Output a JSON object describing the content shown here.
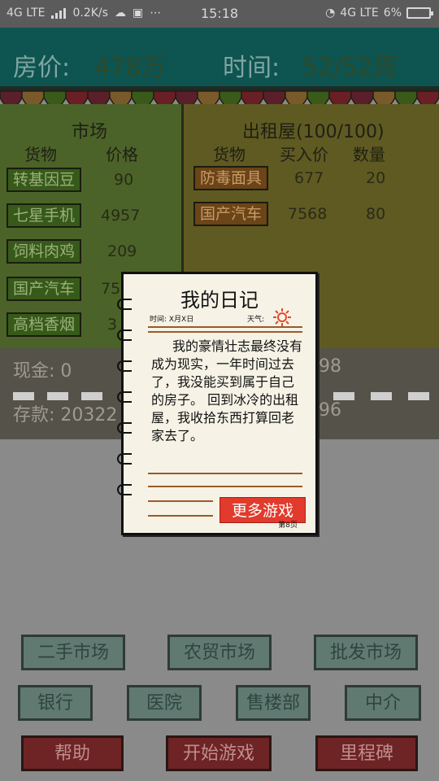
{
  "status_bar": {
    "network_left": "4G LTE",
    "speed": "0.2K/s",
    "time": "15:18",
    "network_right": "4G LTE",
    "battery": "6%"
  },
  "header": {
    "price_label": "房价:",
    "price_value": "478万",
    "time_label": "时间:",
    "time_value": "52/52周"
  },
  "market": {
    "title": "市场",
    "col_goods": "货物",
    "col_price": "价格",
    "items": [
      {
        "name": "转基因豆",
        "price": "90"
      },
      {
        "name": "七星手机",
        "price": "4957"
      },
      {
        "name": "饲料肉鸡",
        "price": "209"
      },
      {
        "name": "国产汽车",
        "price": "75"
      },
      {
        "name": "高档香烟",
        "price": "3"
      }
    ]
  },
  "rental": {
    "title": "出租屋(100/100)",
    "col_goods": "货物",
    "col_buy_price": "买入价",
    "col_quantity": "数量",
    "items": [
      {
        "name": "防毒面具",
        "buy_price": "677",
        "quantity": "20"
      },
      {
        "name": "国产汽车",
        "buy_price": "7568",
        "quantity": "80"
      }
    ]
  },
  "finance": {
    "cash": "现金: 0",
    "deposit": "存款: 20322",
    "right_top": "98",
    "right_bottom": "96"
  },
  "diary": {
    "title": "我的日记",
    "date": "时间: X月X日",
    "weather": "天气:",
    "body": "我的豪情壮志最终没有成为现实，一年时间过去了，我没能买到属于自己的房子。 回到冰冷的出租屋，我收拾东西打算回老家去了。",
    "more_games": "更多游戏",
    "page": "第8页"
  },
  "bottom_buttons": {
    "row1": [
      "二手市场",
      "农贸市场",
      "批发市场"
    ],
    "row2": [
      "银行",
      "医院",
      "售楼部",
      "中介"
    ],
    "row3": [
      "帮助",
      "开始游戏",
      "里程碑"
    ]
  },
  "colors": {
    "top_band": "#0e5451",
    "market_bg": "#4b6328",
    "rental_bg": "#5f5a22",
    "more_button": "#e23a2c"
  }
}
